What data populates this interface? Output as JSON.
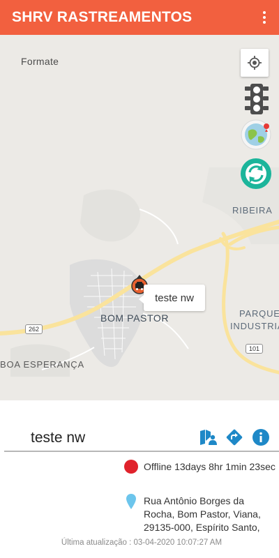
{
  "app": {
    "title": "SHRV RASTREAMENTOS",
    "menu_icon": "more-vert-icon"
  },
  "map": {
    "labels": {
      "formate": "Formate",
      "ribeira": "RIBEIRA",
      "parque_line1": "PARQUE",
      "parque_line2": "INDUSTRIA",
      "bom_pastor": "BOM PASTOR",
      "boa_esperanca": "BOA ESPERANÇA"
    },
    "shields": {
      "road_262": "262",
      "road_101": "101"
    },
    "controls": {
      "my_location": "my-location-icon",
      "traffic": "traffic-light-icon",
      "map_type": "globe-icon",
      "refresh": "refresh-icon"
    },
    "marker": {
      "label": "teste nw",
      "icon": "car-marker-icon"
    },
    "colors": {
      "land": "#eceae6",
      "road": "#fae39c",
      "urban": "#dcdcdc",
      "accent": "#f2603f",
      "refresh": "#1cb59b"
    }
  },
  "panel": {
    "vehicle_name": "teste nw",
    "actions": {
      "street_view": "street-view-icon",
      "directions": "directions-icon",
      "info": "info-icon"
    },
    "status": {
      "text": "Offline 13days 8hr 1min 23sec",
      "color": "#e0222b"
    },
    "address": "Rua Antônio Borges da Rocha, Bom Pastor, Viana, 29135-000, Espírito Santo,",
    "last_update": "Última atualização : 03-04-2020 10:07:27 AM",
    "icon_color": "#1e88c7"
  }
}
